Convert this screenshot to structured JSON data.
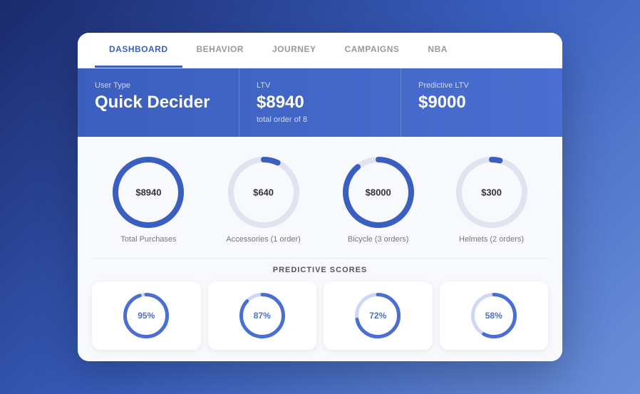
{
  "nav": {
    "tabs": [
      {
        "label": "DASHBOARD",
        "active": true
      },
      {
        "label": "BEHAVIOR",
        "active": false
      },
      {
        "label": "JOURNEY",
        "active": false
      },
      {
        "label": "CAMPAIGNS",
        "active": false
      },
      {
        "label": "NBA",
        "active": false
      }
    ]
  },
  "header": {
    "user_type_label": "User Type",
    "user_type_value": "Quick Decider",
    "ltv_label": "LTV",
    "ltv_value": "$8940",
    "ltv_subtext": "total order of 8",
    "predictive_ltv_label": "Predictive LTV",
    "predictive_ltv_value": "$9000"
  },
  "charts": [
    {
      "value": "$8940",
      "caption": "Total Purchases",
      "percent": 100,
      "color": "#3a5fbf",
      "bg_color": "#d0d7f5"
    },
    {
      "value": "$640",
      "caption": "Accessories (1 order)",
      "percent": 7,
      "color": "#3a5fbf",
      "bg_color": "#e0e4f0"
    },
    {
      "value": "$8000",
      "caption": "Bicycle (3 orders)",
      "percent": 89,
      "color": "#3a5fbf",
      "bg_color": "#e0e4f0"
    },
    {
      "value": "$300",
      "caption": "Helmets (2 orders)",
      "percent": 4,
      "color": "#3a5fbf",
      "bg_color": "#e0e4f0"
    }
  ],
  "predictive_scores": {
    "title": "PREDICTIVE SCORES",
    "scores": [
      {
        "value": "95%",
        "percent": 95
      },
      {
        "value": "87%",
        "percent": 87
      },
      {
        "value": "72%",
        "percent": 72
      },
      {
        "value": "58%",
        "percent": 58
      }
    ]
  }
}
